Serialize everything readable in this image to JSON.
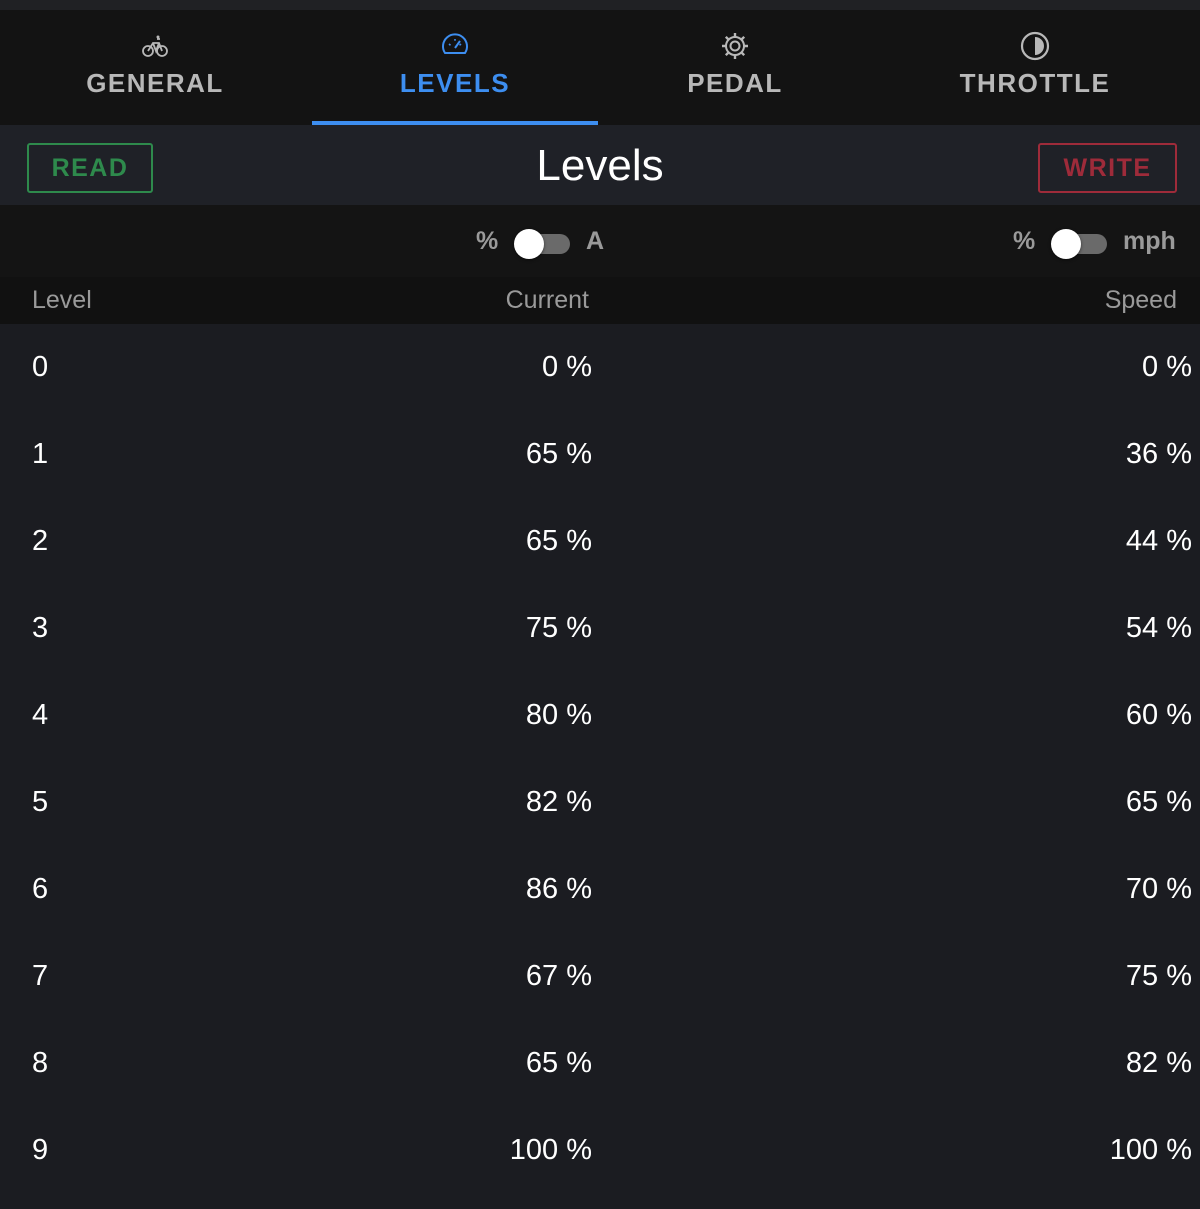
{
  "tabs": [
    {
      "label": "GENERAL",
      "icon": "bike-icon",
      "active": false
    },
    {
      "label": "LEVELS",
      "icon": "speedometer-icon",
      "active": true
    },
    {
      "label": "PEDAL",
      "icon": "gear-icon",
      "active": false
    },
    {
      "label": "THROTTLE",
      "icon": "throttle-icon",
      "active": false
    }
  ],
  "header": {
    "title": "Levels",
    "read_label": "READ",
    "write_label": "WRITE"
  },
  "toggles": {
    "current": {
      "left_label": "%",
      "right_label": "A",
      "on": false
    },
    "speed": {
      "left_label": "%",
      "right_label": "mph",
      "on": false
    }
  },
  "table": {
    "columns": [
      "Level",
      "Current",
      "Speed"
    ],
    "rows": [
      {
        "level": "0",
        "current": "0 %",
        "speed": "0 %"
      },
      {
        "level": "1",
        "current": "65 %",
        "speed": "36 %"
      },
      {
        "level": "2",
        "current": "65 %",
        "speed": "44 %"
      },
      {
        "level": "3",
        "current": "75 %",
        "speed": "54 %"
      },
      {
        "level": "4",
        "current": "80 %",
        "speed": "60 %"
      },
      {
        "level": "5",
        "current": "82 %",
        "speed": "65 %"
      },
      {
        "level": "6",
        "current": "86 %",
        "speed": "70 %"
      },
      {
        "level": "7",
        "current": "67 %",
        "speed": "75 %"
      },
      {
        "level": "8",
        "current": "65 %",
        "speed": "82 %"
      },
      {
        "level": "9",
        "current": "100 %",
        "speed": "100 %"
      }
    ]
  },
  "colors": {
    "accent": "#3d8ef0",
    "read": "#2e8a4c",
    "write": "#9e2b3a"
  }
}
